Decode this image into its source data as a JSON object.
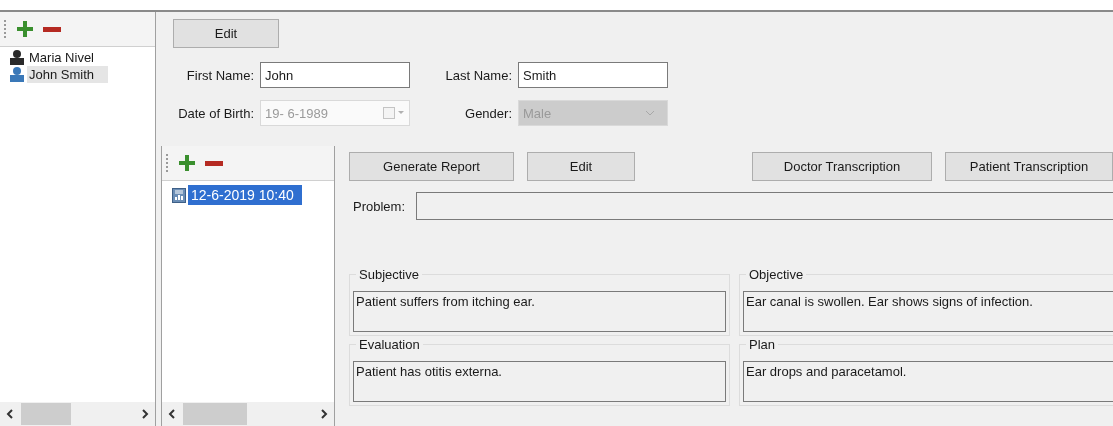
{
  "patients": {
    "items": [
      {
        "name": "Maria Nivel",
        "selected": false
      },
      {
        "name": "John Smith",
        "selected": true
      }
    ]
  },
  "edit_button": {
    "label": "Edit"
  },
  "fields": [
    {
      "label": "First Name:",
      "value": "John",
      "disabled": false,
      "kind": "text"
    },
    {
      "label": "Last Name:",
      "value": "Smith",
      "disabled": false,
      "kind": "text"
    },
    {
      "label": "Date of Birth:",
      "value": "19- 6-1989",
      "disabled": true,
      "kind": "date"
    },
    {
      "label": "Gender:",
      "value": "Male",
      "disabled": true,
      "kind": "combo"
    }
  ],
  "visits": {
    "items": [
      {
        "label": "12-6-2019 10:40",
        "selected": true
      }
    ]
  },
  "report_buttons": [
    {
      "label": "Generate Report"
    },
    {
      "label": "Edit"
    }
  ],
  "transcription_buttons": [
    {
      "label": "Doctor Transcription"
    },
    {
      "label": "Patient Transcription"
    }
  ],
  "problem": {
    "label": "Problem:"
  },
  "sections": [
    {
      "title": "Subjective",
      "text": "Patient suffers from itching ear."
    },
    {
      "title": "Objective",
      "text": "Ear canal is swollen. Ear shows signs of infection."
    },
    {
      "title": "Evaluation",
      "text": "Patient has otitis externa."
    },
    {
      "title": "Plan",
      "text": "Ear drops and paracetamol."
    }
  ]
}
